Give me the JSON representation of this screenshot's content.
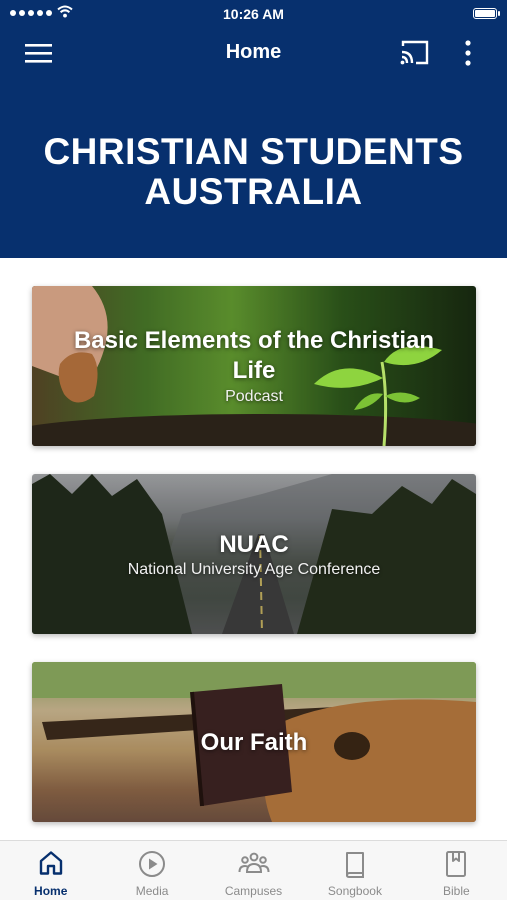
{
  "status_bar": {
    "time": "10:26 AM"
  },
  "header": {
    "title": "Home"
  },
  "hero": {
    "title": "CHRISTIAN STUDENTS AUSTRALIA"
  },
  "cards": [
    {
      "title": "Basic Elements of the Christian Life",
      "subtitle": "Podcast"
    },
    {
      "title": "NUAC",
      "subtitle": "National University Age Conference"
    },
    {
      "title": "Our Faith"
    }
  ],
  "tabs": [
    {
      "label": "Home",
      "icon": "home-icon",
      "active": true
    },
    {
      "label": "Media",
      "icon": "play-circle-icon"
    },
    {
      "label": "Campuses",
      "icon": "people-icon"
    },
    {
      "label": "Songbook",
      "icon": "book-icon"
    },
    {
      "label": "Bible",
      "icon": "bookmark-book-icon"
    }
  ],
  "colors": {
    "primary": "#07306e",
    "tab_inactive": "#8b8b8b",
    "tab_bar_bg": "#f7f7f7"
  }
}
